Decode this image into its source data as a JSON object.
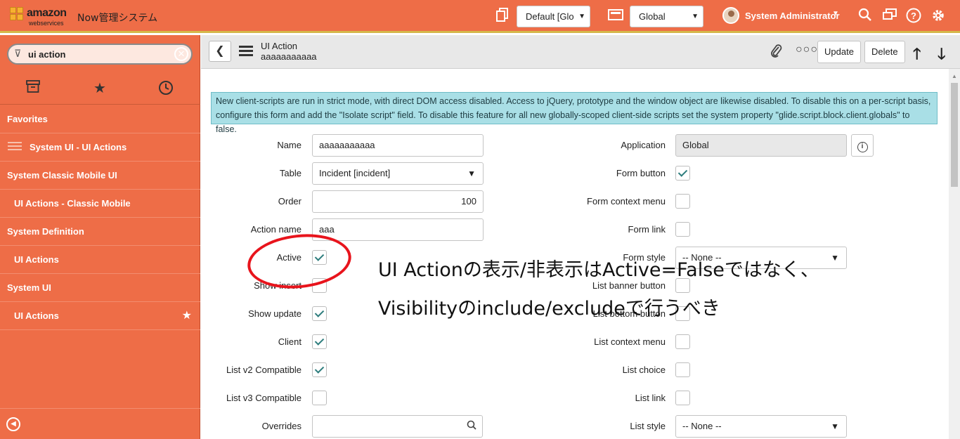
{
  "header": {
    "brand": "amazon",
    "brand_sub": "webservices",
    "app_name": "Now管理システム",
    "update_set_select": "Default [Glo",
    "scope_select": "Global",
    "user_name": "System Administrator"
  },
  "sidebar": {
    "search_value": "ui action",
    "items": [
      {
        "label": "Favorites"
      },
      {
        "label": "System UI - UI Actions"
      },
      {
        "label": "System Classic Mobile UI"
      },
      {
        "label": "UI Actions - Classic Mobile"
      },
      {
        "label": "System Definition"
      },
      {
        "label": "UI Actions"
      },
      {
        "label": "System UI"
      },
      {
        "label": "UI Actions"
      }
    ]
  },
  "form_header": {
    "title": "UI Action",
    "subtitle": "aaaaaaaaaaa",
    "update_label": "Update",
    "delete_label": "Delete"
  },
  "notice": "New client-scripts are run in strict mode, with direct DOM access disabled. Access to jQuery, prototype and the window object are likewise disabled. To disable this on a per-script basis, configure this form and add the \"Isolate script\" field. To disable this feature for all new globally-scoped client-side scripts set the system property \"glide.script.block.client.globals\" to false.",
  "form": {
    "left": {
      "name_label": "Name",
      "name_value": "aaaaaaaaaaa",
      "table_label": "Table",
      "table_value": "Incident [incident]",
      "order_label": "Order",
      "order_value": "100",
      "action_name_label": "Action name",
      "action_name_value": "aaa",
      "active_label": "Active",
      "active": true,
      "show_insert_label": "Show insert",
      "show_insert": false,
      "show_update_label": "Show update",
      "show_update": true,
      "client_label": "Client",
      "client": true,
      "list_v2_label": "List v2 Compatible",
      "list_v2": true,
      "list_v3_label": "List v3 Compatible",
      "list_v3": false,
      "overrides_label": "Overrides",
      "overrides_value": ""
    },
    "right": {
      "application_label": "Application",
      "application_value": "Global",
      "form_button_label": "Form button",
      "form_button": true,
      "form_context_menu_label": "Form context menu",
      "form_context_menu": false,
      "form_link_label": "Form link",
      "form_link": false,
      "form_style_label": "Form style",
      "form_style_value": "-- None --",
      "list_banner_button_label": "List banner button",
      "list_banner_button": false,
      "list_bottom_button_label": "List bottom button",
      "list_bottom_button": false,
      "list_context_menu_label": "List context menu",
      "list_context_menu": false,
      "list_choice_label": "List choice",
      "list_choice": false,
      "list_link_label": "List link",
      "list_link": false,
      "list_style_label": "List style",
      "list_style_value": "-- None --"
    }
  },
  "annotation": {
    "line1": "UI Actionの表示/非表示はActive=Falseではなく、",
    "line2": "Visibilityのinclude/excludeで行うべき",
    "color": "#e8141c"
  }
}
